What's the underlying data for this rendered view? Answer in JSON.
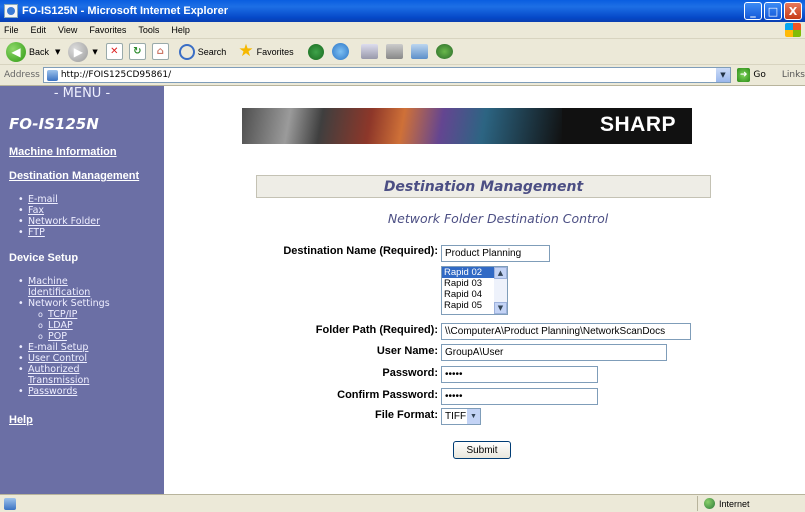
{
  "window": {
    "title": "FO-IS125N - Microsoft Internet Explorer",
    "buttons": {
      "minimize": "_",
      "maximize": "□",
      "close": "X"
    }
  },
  "menubar": [
    "File",
    "Edit",
    "View",
    "Favorites",
    "Tools",
    "Help"
  ],
  "toolbar": {
    "back_label": "Back",
    "search_label": "Search",
    "favorites_label": "Favorites"
  },
  "address": {
    "label": "Address",
    "url": "http://FOIS125CD95861/",
    "go_label": "Go",
    "links_label": "Links"
  },
  "sidebar": {
    "menu_title": "- MENU -",
    "model": "FO-IS125N",
    "machine_info": "Machine Information",
    "destination_management": "Destination Management",
    "destination_items": [
      "E-mail",
      "Fax",
      "Network Folder",
      "FTP"
    ],
    "device_setup": "Device Setup",
    "device_items": {
      "machine_identification": "Machine Identification",
      "network_settings": "Network Settings",
      "network_sub": [
        "TCP/IP",
        "LDAP",
        "POP"
      ],
      "email_setup": "E-mail Setup",
      "user_control": "User Control",
      "authorized_transmission": "Authorized Transmission",
      "passwords": "Passwords"
    },
    "help": "Help"
  },
  "banner": {
    "logo": "SHARP"
  },
  "main": {
    "heading": "Destination Management",
    "subtitle": "Network Folder Destination Control",
    "destination_name_label": "Destination Name (Required):",
    "destination_name_value": "Product Planning",
    "rapid_list": [
      "Rapid 02",
      "Rapid 03",
      "Rapid 04",
      "Rapid 05"
    ],
    "rapid_selected": "Rapid 02",
    "folder_path_label": "Folder Path (Required):",
    "folder_path_value": "\\\\ComputerA\\Product Planning\\NetworkScanDocs",
    "user_name_label": "User Name:",
    "user_name_value": "GroupA\\User",
    "password_label": "Password:",
    "password_value": "•••••",
    "confirm_password_label": "Confirm Password:",
    "confirm_password_value": "•••••",
    "file_format_label": "File Format:",
    "file_format_value": "TIFF",
    "submit_label": "Submit"
  },
  "statusbar": {
    "zone": "Internet"
  }
}
